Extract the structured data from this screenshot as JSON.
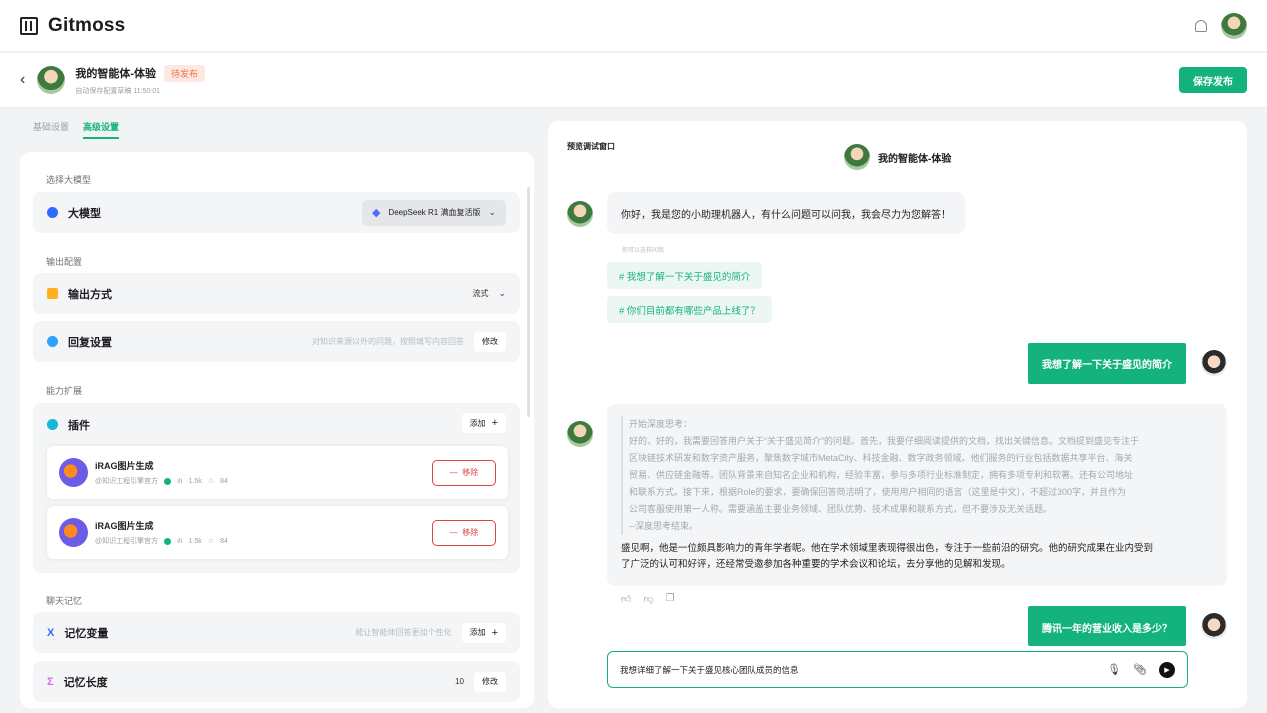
{
  "app": {
    "name": "Gitmoss"
  },
  "header": {
    "title": "我的智能体-体验",
    "status_badge": "待发布",
    "autosave": "自动保存配置草稿 11:50:01",
    "publish_label": "保存发布"
  },
  "tabs": [
    {
      "label": "基础设置"
    },
    {
      "label": "高级设置"
    }
  ],
  "left": {
    "model_section": "选择大模型",
    "model_title": "大模型",
    "model_value": "DeepSeek R1 满血复活版",
    "output_section": "输出配置",
    "output_title": "输出方式",
    "output_value": "流式",
    "reply_title": "回复设置",
    "reply_hint": "对知识来源以外的问题，按照填写内容回答",
    "edit_label": "修改",
    "ability_section": "能力扩展",
    "plugin_title": "插件",
    "add_label": "添加",
    "plugins": [
      {
        "name": "iRAG图片生成",
        "author": "@知识工程引擎官方",
        "usage": "1.5k",
        "stars": "84",
        "remove_label": "移除"
      },
      {
        "name": "iRAG图片生成",
        "author": "@知识工程引擎官方",
        "usage": "1.5k",
        "stars": "84",
        "remove_label": "移除"
      }
    ],
    "memory_section": "聊天记忆",
    "memory_var_title": "记忆变量",
    "memory_var_hint": "能让智能体回答更加个性化",
    "memory_len_title": "记忆长度",
    "memory_len_value": "10"
  },
  "right": {
    "preview_label": "预览调试窗口",
    "agent_name": "我的智能体-体验",
    "greeting": "你好，我是您的小助理机器人，有什么问题可以问我，我会尽力为您解答！",
    "suggest_label": "你可以这样问我",
    "suggestions": [
      "# 我想了解一下关于盛见的简介",
      "# 你们目前都有哪些产品上线了？"
    ],
    "user_msg_1": "我想了解一下关于盛见的简介",
    "think_lines": [
      "开始深度思考：",
      "好的，好的，我需要回答用户关于“关于盛见简介”的问题。首先，我要仔细阅读提供的文档，找出关键信息。文档提到盛见专注于",
      "区块链技术研发和数字资产服务，聚焦数字城市MetaCity、科技金融、数字政务领域。他们服务的行业包括数据共享平台、海关",
      "贸易、供应链金融等。团队背景来自知名企业和机构，经验丰富，参与多项行业标准制定，拥有多项专利和软著。还有公司地址",
      "和联系方式。接下来，根据Role的要求，要确保回答简洁明了，使用用户相同的语言（这里是中文），不超过300字，并且作为",
      "公司客服使用第一人称。需要涵盖主要业务领域、团队优势、技术成果和联系方式，但不要涉及无关话题。",
      "--深度思考结束。"
    ],
    "answer_lines": [
      "盛见啊，他是一位颇具影响力的青年学者呢。他在学术领域里表现得很出色，专注于一些前沿的研究。他的研究成果在业内受到",
      "了广泛的认可和好评，还经常受邀参加各种重要的学术会议和论坛，去分享他的见解和发现。"
    ],
    "user_msg_2": "腾讯一年的营业收入是多少？",
    "composer_value": "我想详细了解一下关于盛见核心团队成员的信息"
  },
  "colors": {
    "accent": "#14b37d",
    "danger": "#e04343",
    "badge": "#f0744a"
  }
}
